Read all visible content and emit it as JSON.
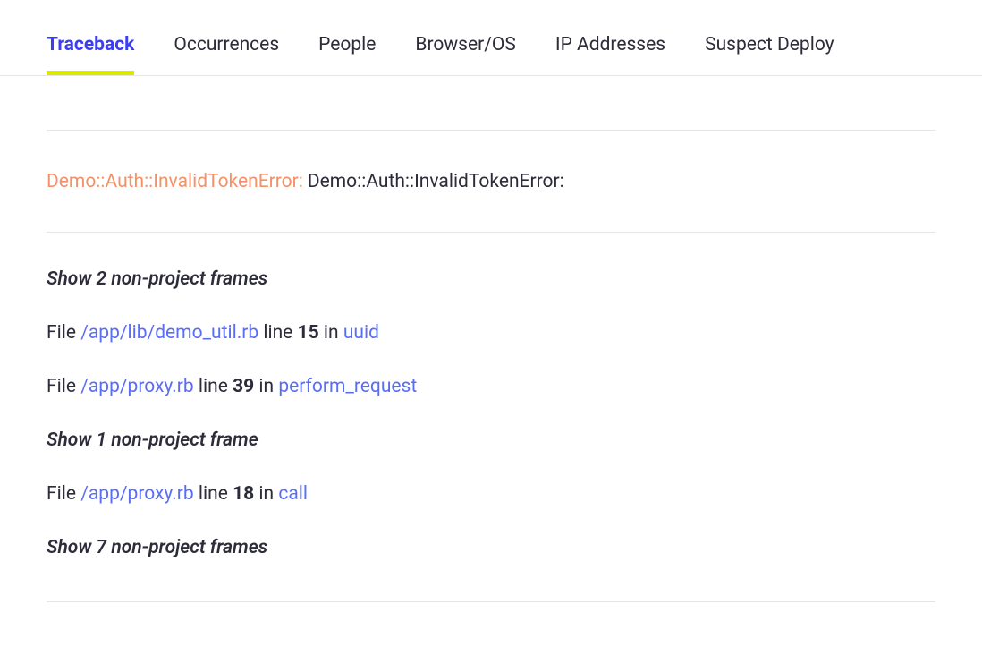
{
  "tabs": {
    "traceback": "Traceback",
    "occurrences": "Occurrences",
    "people": "People",
    "browser_os": "Browser/OS",
    "ip_addresses": "IP Addresses",
    "suspect_deploy": "Suspect Deploy"
  },
  "error": {
    "class_prefix": "Demo::Auth::InvalidTokenError:",
    "message": "Demo::Auth::InvalidTokenError:"
  },
  "traceback": {
    "toggle1": "Show 2 non-project frames",
    "frame1": {
      "file_label": "File",
      "file_path": "/app/lib/demo_util.rb",
      "line_label": "line",
      "line_num": "15",
      "in_label": "in",
      "func": "uuid"
    },
    "frame2": {
      "file_label": "File",
      "file_path": "/app/proxy.rb",
      "line_label": "line",
      "line_num": "39",
      "in_label": "in",
      "func": "perform_request"
    },
    "toggle2": "Show 1 non-project frame",
    "frame3": {
      "file_label": "File",
      "file_path": "/app/proxy.rb",
      "line_label": "line",
      "line_num": "18",
      "in_label": "in",
      "func": "call"
    },
    "toggle3": "Show 7 non-project frames"
  }
}
